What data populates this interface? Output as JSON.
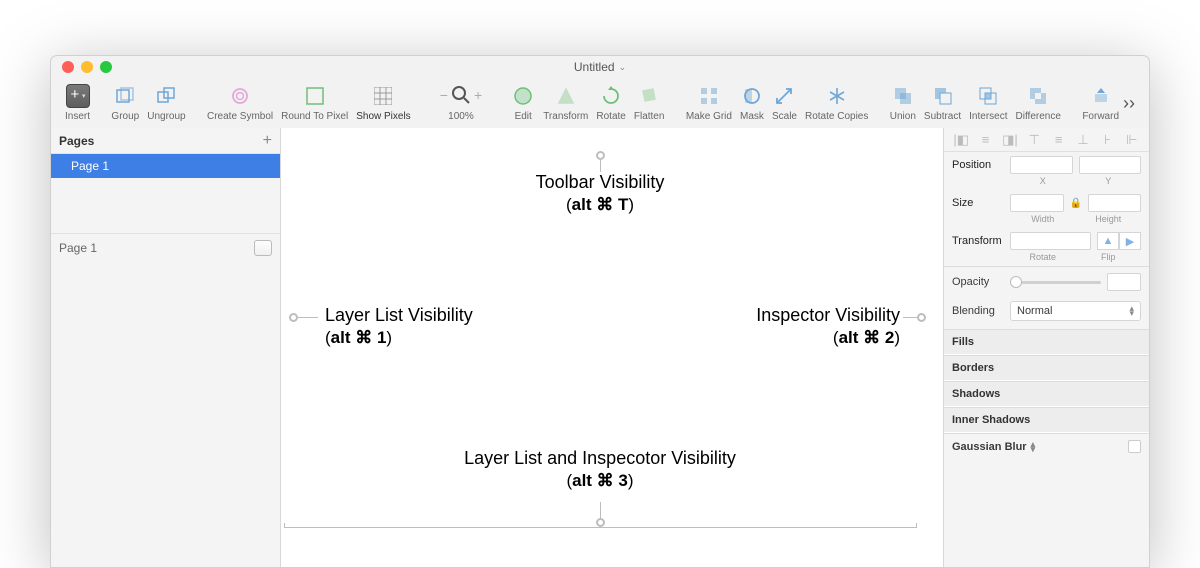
{
  "window": {
    "title": "Untitled"
  },
  "toolbar": {
    "insert": "Insert",
    "group": "Group",
    "ungroup": "Ungroup",
    "create_symbol": "Create Symbol",
    "round_to_pixel": "Round To Pixel",
    "show_pixels": "Show Pixels",
    "zoom": "100%",
    "edit": "Edit",
    "transform": "Transform",
    "rotate": "Rotate",
    "flatten": "Flatten",
    "make_grid": "Make Grid",
    "mask": "Mask",
    "scale": "Scale",
    "rotate_copies": "Rotate Copies",
    "union": "Union",
    "subtract": "Subtract",
    "intersect": "Intersect",
    "difference": "Difference",
    "forward": "Forward"
  },
  "sidebar": {
    "pages_label": "Pages",
    "page_name": "Page 1",
    "layer_name": "Page 1"
  },
  "inspector": {
    "position": "Position",
    "x": "X",
    "y": "Y",
    "size": "Size",
    "width": "Width",
    "height": "Height",
    "transform": "Transform",
    "rotate_sub": "Rotate",
    "flip_sub": "Flip",
    "opacity": "Opacity",
    "blending": "Blending",
    "blending_value": "Normal",
    "fills": "Fills",
    "borders": "Borders",
    "shadows": "Shadows",
    "inner_shadows": "Inner Shadows",
    "gaussian": "Gaussian Blur"
  },
  "annotations": {
    "toolbar_vis": "Toolbar Visibility",
    "toolbar_key": "alt ⌘ T",
    "layerlist_vis": "Layer List Visibility",
    "layerlist_key": "alt ⌘ 1",
    "inspector_vis": "Inspector Visibility",
    "inspector_key": "alt ⌘ 2",
    "both_vis": "Layer List and Inspecotor Visibility",
    "both_key": "alt ⌘ 3"
  }
}
